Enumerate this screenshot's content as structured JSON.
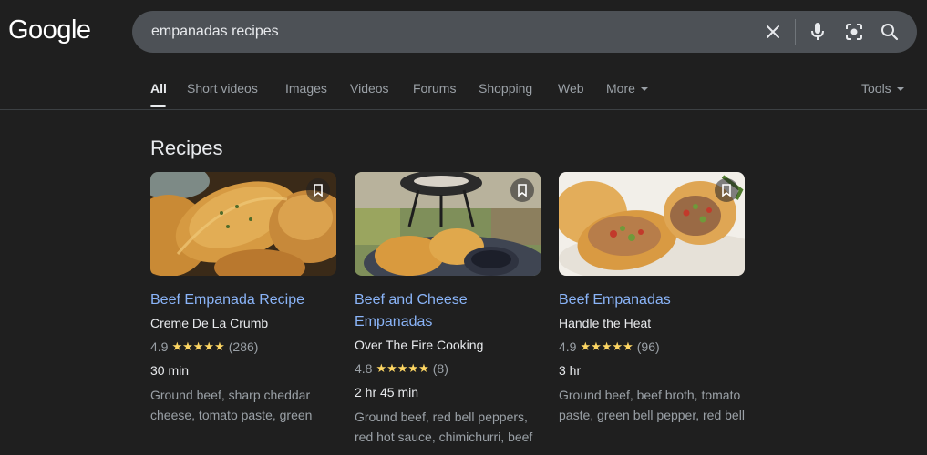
{
  "header": {
    "logo": "Google",
    "search_query": "empanadas recipes"
  },
  "tabs": [
    {
      "label": "All",
      "active": true
    },
    {
      "label": "Short videos"
    },
    {
      "label": "Images"
    },
    {
      "label": "Videos"
    },
    {
      "label": "Forums"
    },
    {
      "label": "Shopping"
    },
    {
      "label": "Web"
    },
    {
      "label": "More"
    }
  ],
  "tools_label": "Tools",
  "section_title": "Recipes",
  "recipes": [
    {
      "title": "Beef Empanada Recipe",
      "source": "Creme De La Crumb",
      "rating": "4.9",
      "reviews": "(286)",
      "time": "30 min",
      "ingredients": "Ground beef, sharp cheddar cheese, tomato paste, green"
    },
    {
      "title": "Beef and Cheese Empanadas",
      "source": "Over The Fire Cooking",
      "rating": "4.8",
      "reviews": "(8)",
      "time": "2 hr 45 min",
      "ingredients": "Ground beef, red bell peppers, red hot sauce, chimichurri, beef"
    },
    {
      "title": "Beef Empanadas",
      "source": "Handle the Heat",
      "rating": "4.9",
      "reviews": "(96)",
      "time": "3 hr",
      "ingredients": "Ground beef, beef broth, tomato paste, green bell pepper, red bell"
    }
  ],
  "stars": "★★★★★",
  "colors": {
    "background": "#1f1f1f",
    "searchbox": "#4d5156",
    "link": "#8ab4f8",
    "star": "#fdd663",
    "muted": "#9aa0a6"
  },
  "icons": [
    "clear-icon",
    "microphone-icon",
    "lens-icon",
    "search-icon",
    "bookmark-icon"
  ]
}
